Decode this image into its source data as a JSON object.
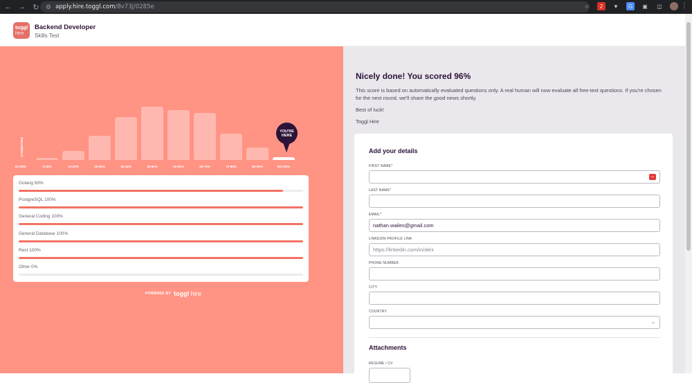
{
  "browser": {
    "nav_icons": [
      "back-arrow",
      "forward-arrow",
      "reload"
    ],
    "url_host": "apply.hire.toggl.com",
    "url_path": "/8v73j/0285e",
    "ext_badge": "2"
  },
  "header": {
    "logo_top": "toggl",
    "logo_bottom": "hire",
    "title": "Backend Developer",
    "subtitle": "Skills Test"
  },
  "chart": {
    "y_label": "CANDIDATES",
    "score_label": "SCORE:",
    "pin_label_1": "YOU'RE",
    "pin_label_2": "HERE"
  },
  "chart_data": {
    "type": "bar",
    "categories": [
      "0-10%",
      "10-20%",
      "20-30%",
      "30-40%",
      "40-50%",
      "50-60%",
      "60-70%",
      "70-80%",
      "80-90%",
      "90-100%"
    ],
    "values": [
      3,
      15,
      40,
      70,
      88,
      82,
      77,
      43,
      20,
      4
    ],
    "highlight_index": 9,
    "ylabel": "CANDIDATES",
    "xlabel": "SCORE:"
  },
  "skills": [
    {
      "label": "Golang 93%",
      "value": 93
    },
    {
      "label": "PostgreSQL 100%",
      "value": 100
    },
    {
      "label": "General Coding 100%",
      "value": 100
    },
    {
      "label": "General Database 100%",
      "value": 100
    },
    {
      "label": "Rest 100%",
      "value": 100
    },
    {
      "label": "Other 0%",
      "value": 0
    }
  ],
  "powered": {
    "prefix": "POWERED BY",
    "brand": "toggl",
    "brand_suffix": "hire"
  },
  "result": {
    "title": "Nicely done! You scored 96%",
    "text": "This score is based on automatically evaluated questions only. A real human will now evaluate all free-text questions. If you're chosen for the next round, we'll share the good news shortly.",
    "luck": "Best of luck!",
    "sign": "Toggl Hire"
  },
  "form": {
    "title": "Add your details",
    "first_name_label": "FIRST NAME*",
    "first_name_value": "",
    "last_name_label": "LAST NAME*",
    "last_name_value": "",
    "email_label": "EMAIL*",
    "email_value": "nathan.wailes@gmail.com",
    "linkedin_label": "LINKEDIN PROFILE LINK",
    "linkedin_placeholder": "https://linkedin.com/in/alex",
    "phone_label": "PHONE NUMBER",
    "city_label": "CITY",
    "country_label": "COUNTRY",
    "attachments_title": "Attachments",
    "resume_label": "RESUME / CV",
    "password_manager_icon": "***"
  }
}
